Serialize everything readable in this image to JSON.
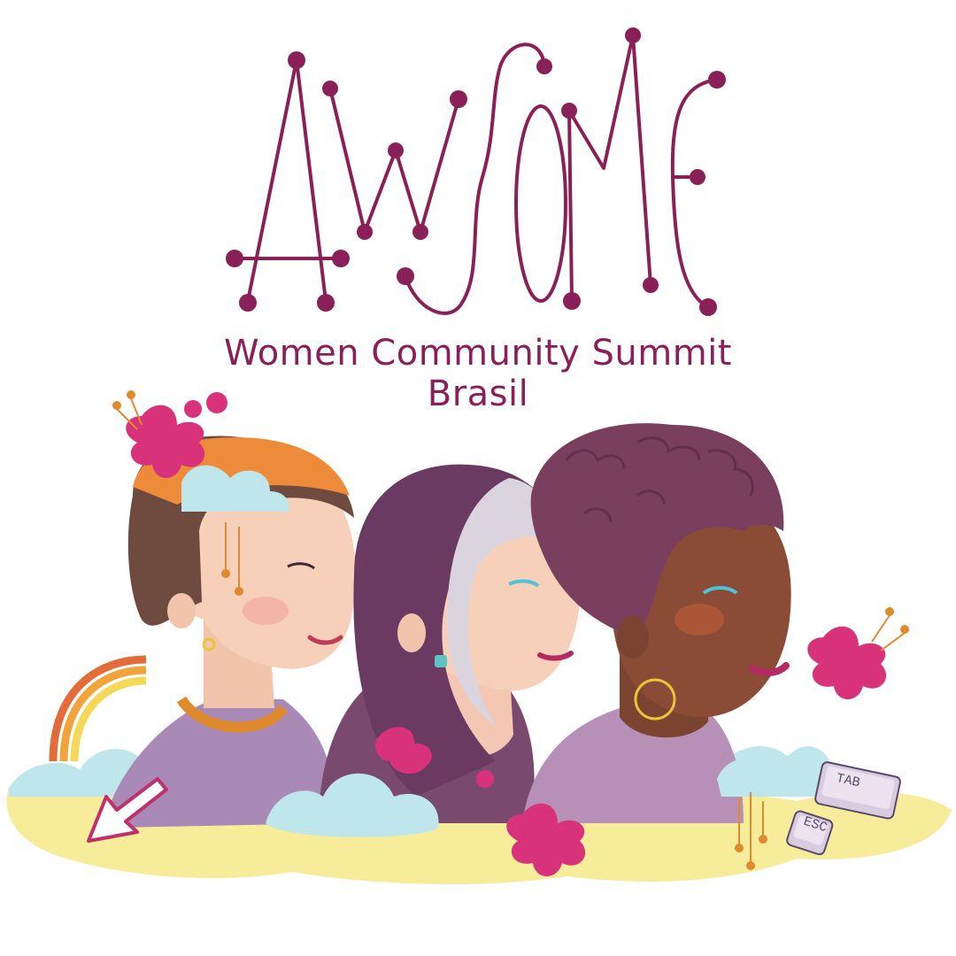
{
  "logo": {
    "wordmark": "AWSOME",
    "subtitle_line1": "Women Community Summit",
    "subtitle_line2": "Brasil"
  },
  "illustration": {
    "keys": [
      "TAB",
      "ESC"
    ],
    "icons": [
      "cursor-arrow-icon",
      "rainbow-icon",
      "cloud-icon",
      "flower-icon"
    ]
  },
  "colors": {
    "brand": "#8a2058",
    "accent_pink": "#d8327a",
    "cloud": "#bfe6ea",
    "ground": "#f6ec9a"
  }
}
